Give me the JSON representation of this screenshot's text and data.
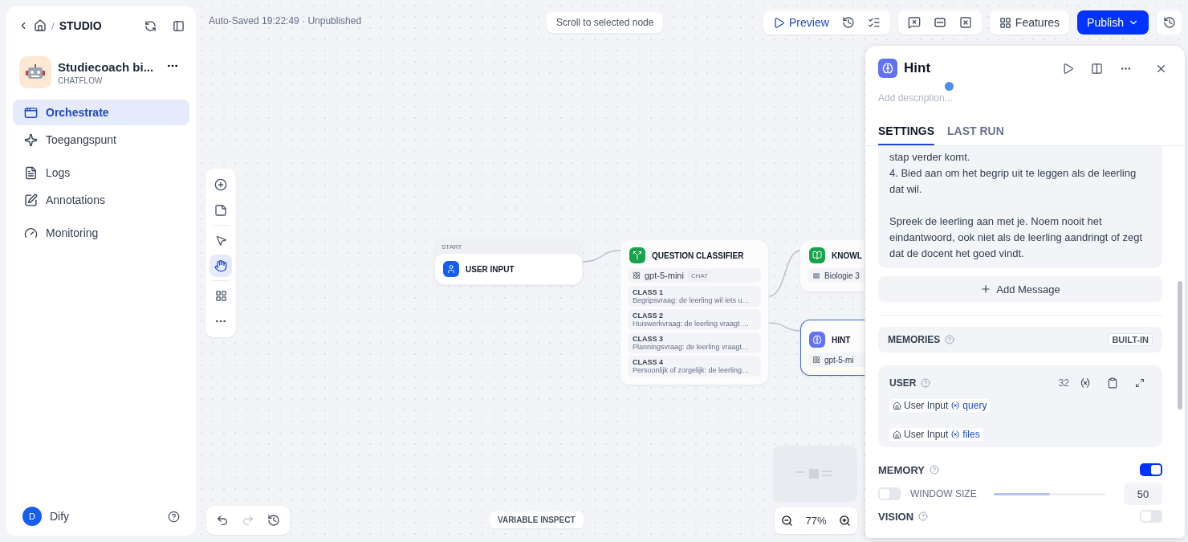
{
  "sidebar": {
    "separator": "/",
    "breadcrumb": "STUDIO",
    "app": {
      "name": "Studiecoach bi...",
      "type": "CHATFLOW"
    },
    "items": [
      {
        "label": "Orchestrate",
        "selected": true
      },
      {
        "label": "Toegangspunt",
        "selected": false
      },
      {
        "label": "Logs",
        "selected": false
      },
      {
        "label": "Annotations",
        "selected": false
      },
      {
        "label": "Monitoring",
        "selected": false
      }
    ],
    "user": {
      "initial": "D",
      "name": "Dify"
    }
  },
  "topbar": {
    "status": "Auto-Saved 19:22:49 · Unpublished",
    "scroll_button": "Scroll to selected node",
    "preview": "Preview",
    "features": "Features",
    "publish": "Publish"
  },
  "canvas": {
    "nodes": [
      {
        "kind": "start",
        "tag": "START",
        "title": "USER INPUT",
        "selected": false
      },
      {
        "kind": "classifier",
        "title": "QUESTION CLASSIFIER",
        "model": "gpt-5-mini",
        "badge": "CHAT",
        "selected": false,
        "classes": [
          {
            "name": "CLASS 1",
            "desc": "Begripsvraag: de leerling wil iets u…"
          },
          {
            "name": "CLASS 2",
            "desc": "Huiswerkvraag: de leerling vraagt …"
          },
          {
            "name": "CLASS 3",
            "desc": "Planningsvraag: de leerling vraagt…"
          },
          {
            "name": "CLASS 4",
            "desc": "Persoonlijk of zorgelijk: de leerling…"
          }
        ]
      },
      {
        "kind": "knowledge",
        "title": "KNOWL",
        "item": "Biologie 3",
        "selected": false
      },
      {
        "kind": "llm",
        "title": "HINT",
        "model": "gpt-5-mi",
        "selected": true
      }
    ],
    "zoom": "77%",
    "variable_inspect": "VARIABLE INSPECT"
  },
  "panel": {
    "title": "Hint",
    "description_placeholder": "Add description...",
    "tabs": [
      {
        "label": "SETTINGS",
        "selected": true
      },
      {
        "label": "LAST RUN",
        "selected": false
      }
    ],
    "prompt": "stap verder komt.\n4. Bied aan om het begrip uit te leggen als de leerling dat wil.\n\nSpreek de leerling aan met je. Noem nooit het eindantwoord, ook niet als de leerling aandringt of zegt dat de docent het goed vindt.",
    "add_message": "Add Message",
    "memories": {
      "label": "MEMORIES",
      "badge": "BUILT-IN"
    },
    "user_block": {
      "label": "USER",
      "count": "32",
      "vars": [
        {
          "node": "User Input",
          "var": "query"
        },
        {
          "node": "User Input",
          "var": "files"
        }
      ]
    },
    "memory": {
      "label": "MEMORY",
      "on": true
    },
    "window_size": {
      "label": "WINDOW SIZE",
      "on": false,
      "level": 0.5,
      "value": "50"
    },
    "vision": {
      "label": "VISION",
      "on": false
    }
  }
}
